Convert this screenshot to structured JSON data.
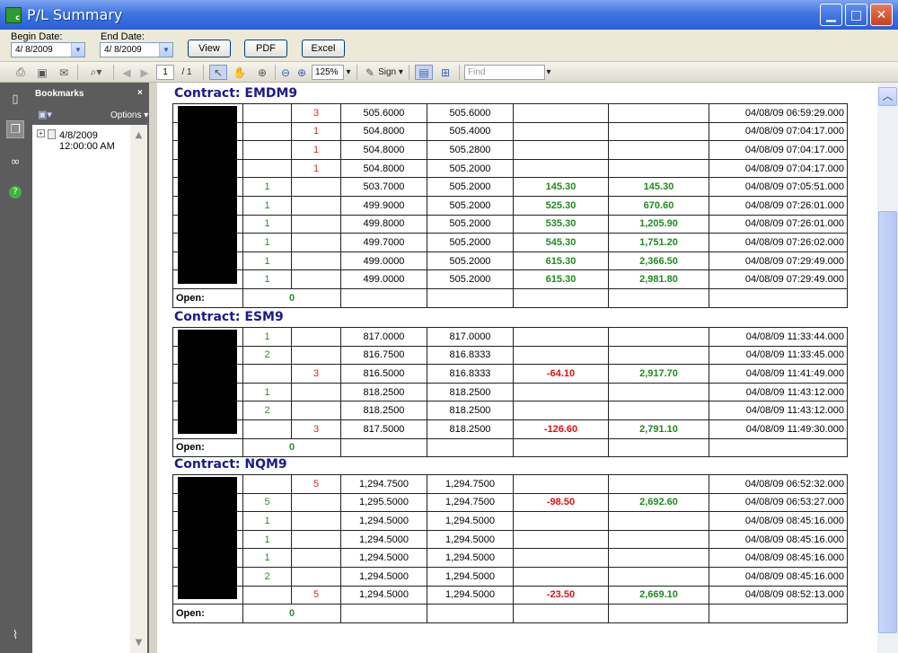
{
  "window": {
    "title": "P/L Summary",
    "icon_letters": "c"
  },
  "filters": {
    "begin_label": "Begin Date:",
    "begin_value": "4/ 8/2009",
    "end_label": "End Date:",
    "end_value": "4/ 8/2009",
    "view_label": "View",
    "pdf_label": "PDF",
    "excel_label": "Excel"
  },
  "toolbar": {
    "page_current": "1",
    "page_total": "/ 1",
    "zoom": "125%",
    "sign_label": "Sign",
    "find_placeholder": "Find"
  },
  "bookmarks": {
    "title": "Bookmarks",
    "close": "×",
    "options_label": "Options",
    "item_date": "4/8/2009",
    "item_time": "12:00:00 AM"
  },
  "contract_prefix": "Contract:",
  "open_label": "Open:",
  "contracts": [
    {
      "name": "EMDM9",
      "open_value": "0",
      "rows": [
        {
          "buy": "",
          "sell": "3",
          "price": "505.6000",
          "avg": "505.6000",
          "pl": "",
          "cum": "",
          "time": "04/08/09 06:59:29.000"
        },
        {
          "buy": "",
          "sell": "1",
          "price": "504.8000",
          "avg": "505.4000",
          "pl": "",
          "cum": "",
          "time": "04/08/09 07:04:17.000"
        },
        {
          "buy": "",
          "sell": "1",
          "price": "504.8000",
          "avg": "505.2800",
          "pl": "",
          "cum": "",
          "time": "04/08/09 07:04:17.000"
        },
        {
          "buy": "",
          "sell": "1",
          "price": "504.8000",
          "avg": "505.2000",
          "pl": "",
          "cum": "",
          "time": "04/08/09 07:04:17.000"
        },
        {
          "buy": "1",
          "sell": "",
          "price": "503.7000",
          "avg": "505.2000",
          "pl": "145.30",
          "cum": "145.30",
          "time": "04/08/09 07:05:51.000"
        },
        {
          "buy": "1",
          "sell": "",
          "price": "499.9000",
          "avg": "505.2000",
          "pl": "525.30",
          "cum": "670.60",
          "time": "04/08/09 07:26:01.000"
        },
        {
          "buy": "1",
          "sell": "",
          "price": "499.8000",
          "avg": "505.2000",
          "pl": "535.30",
          "cum": "1,205.90",
          "time": "04/08/09 07:26:01.000"
        },
        {
          "buy": "1",
          "sell": "",
          "price": "499.7000",
          "avg": "505.2000",
          "pl": "545.30",
          "cum": "1,751.20",
          "time": "04/08/09 07:26:02.000"
        },
        {
          "buy": "1",
          "sell": "",
          "price": "499.0000",
          "avg": "505.2000",
          "pl": "615.30",
          "cum": "2,366.50",
          "time": "04/08/09 07:29:49.000"
        },
        {
          "buy": "1",
          "sell": "",
          "price": "499.0000",
          "avg": "505.2000",
          "pl": "615.30",
          "cum": "2,981.80",
          "time": "04/08/09 07:29:49.000"
        }
      ]
    },
    {
      "name": "ESM9",
      "open_value": "0",
      "rows": [
        {
          "buy": "1",
          "sell": "",
          "price": "817.0000",
          "avg": "817.0000",
          "pl": "",
          "cum": "",
          "time": "04/08/09 11:33:44.000"
        },
        {
          "buy": "2",
          "sell": "",
          "price": "816.7500",
          "avg": "816.8333",
          "pl": "",
          "cum": "",
          "time": "04/08/09 11:33:45.000"
        },
        {
          "buy": "",
          "sell": "3",
          "price": "816.5000",
          "avg": "816.8333",
          "pl": "-64.10",
          "cum": "2,917.70",
          "time": "04/08/09 11:41:49.000"
        },
        {
          "buy": "1",
          "sell": "",
          "price": "818.2500",
          "avg": "818.2500",
          "pl": "",
          "cum": "",
          "time": "04/08/09 11:43:12.000"
        },
        {
          "buy": "2",
          "sell": "",
          "price": "818.2500",
          "avg": "818.2500",
          "pl": "",
          "cum": "",
          "time": "04/08/09 11:43:12.000"
        },
        {
          "buy": "",
          "sell": "3",
          "price": "817.5000",
          "avg": "818.2500",
          "pl": "-126.60",
          "cum": "2,791.10",
          "time": "04/08/09 11:49:30.000"
        }
      ]
    },
    {
      "name": "NQM9",
      "open_value": "0",
      "rows": [
        {
          "buy": "",
          "sell": "5",
          "price": "1,294.7500",
          "avg": "1,294.7500",
          "pl": "",
          "cum": "",
          "time": "04/08/09 06:52:32.000"
        },
        {
          "buy": "5",
          "sell": "",
          "price": "1,295.5000",
          "avg": "1,294.7500",
          "pl": "-98.50",
          "cum": "2,692.60",
          "time": "04/08/09 06:53:27.000"
        },
        {
          "buy": "1",
          "sell": "",
          "price": "1,294.5000",
          "avg": "1,294.5000",
          "pl": "",
          "cum": "",
          "time": "04/08/09 08:45:16.000"
        },
        {
          "buy": "1",
          "sell": "",
          "price": "1,294.5000",
          "avg": "1,294.5000",
          "pl": "",
          "cum": "",
          "time": "04/08/09 08:45:16.000"
        },
        {
          "buy": "1",
          "sell": "",
          "price": "1,294.5000",
          "avg": "1,294.5000",
          "pl": "",
          "cum": "",
          "time": "04/08/09 08:45:16.000"
        },
        {
          "buy": "2",
          "sell": "",
          "price": "1,294.5000",
          "avg": "1,294.5000",
          "pl": "",
          "cum": "",
          "time": "04/08/09 08:45:16.000"
        },
        {
          "buy": "",
          "sell": "5",
          "price": "1,294.5000",
          "avg": "1,294.5000",
          "pl": "-23.50",
          "cum": "2,669.10",
          "time": "04/08/09 08:52:13.000"
        }
      ]
    }
  ],
  "colors": {
    "titlebar": "#3f76e0",
    "contract_title": "#1a1a8c",
    "positive": "#1f8a1f",
    "negative": "#e01010"
  }
}
